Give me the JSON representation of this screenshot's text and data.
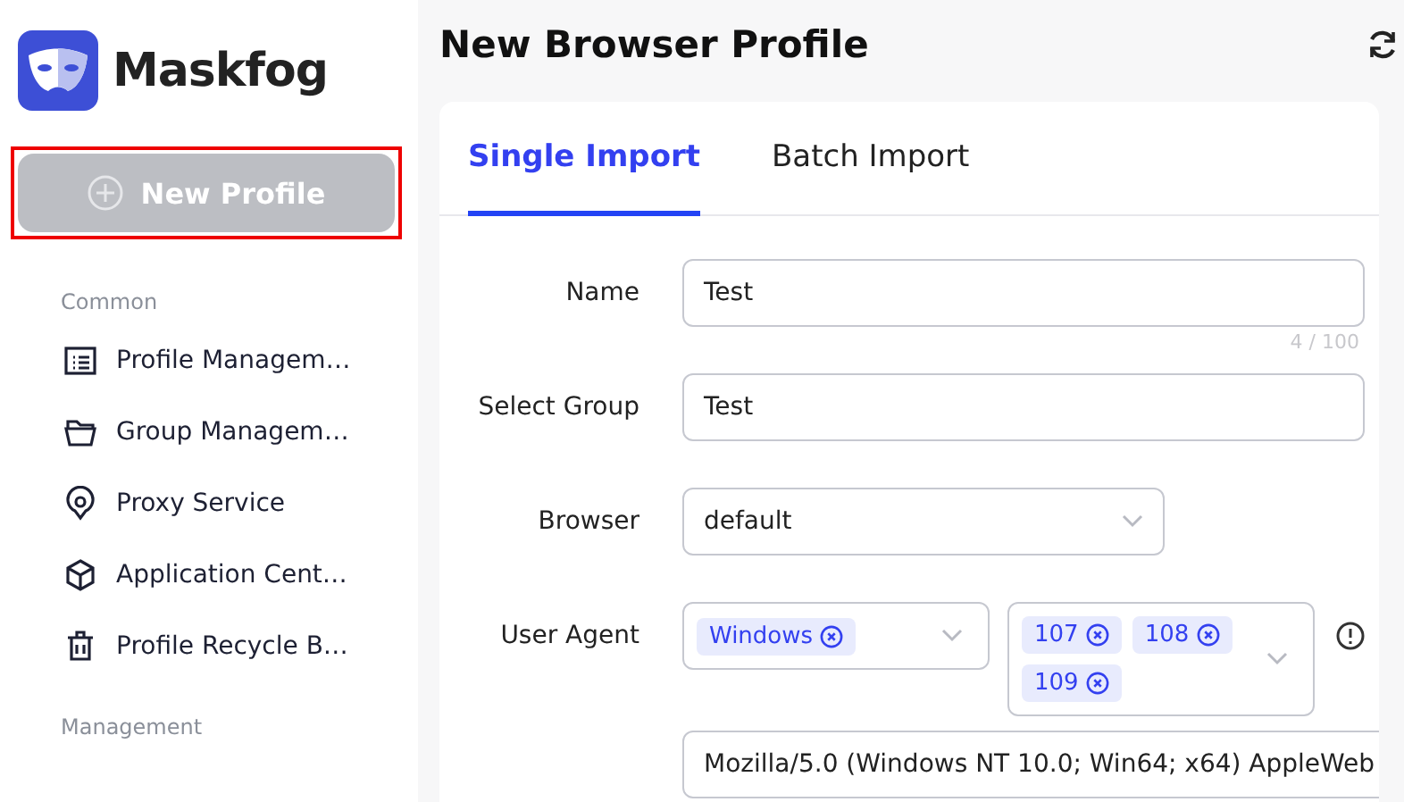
{
  "brand": {
    "name": "Maskfog"
  },
  "new_profile_button": {
    "label": "New Profile",
    "highlighted": true
  },
  "sidebar": {
    "sections": [
      {
        "title": "Common",
        "items": [
          {
            "label": "Profile Managem…",
            "kind": "list"
          },
          {
            "label": "Group Managem…",
            "kind": "folder"
          },
          {
            "label": "Proxy Service",
            "kind": "pin"
          },
          {
            "label": "Application Cent…",
            "kind": "cube"
          },
          {
            "label": "Profile Recycle B…",
            "kind": "trash"
          }
        ]
      },
      {
        "title": "Management"
      }
    ]
  },
  "page": {
    "title": "New Browser Profile"
  },
  "tabs": [
    {
      "label": "Single Import",
      "selected": true
    },
    {
      "label": "Batch Import",
      "selected": false
    }
  ],
  "form": {
    "name": {
      "label": "Name",
      "value": "Test",
      "counter": "4 / 100"
    },
    "group": {
      "label": "Select Group",
      "value": "Test"
    },
    "browser": {
      "label": "Browser",
      "value": "default"
    },
    "user_agent": {
      "label": "User Agent",
      "os_tags": [
        "Windows"
      ],
      "version_tags": [
        "107",
        "108",
        "109"
      ],
      "value": "Mozilla/5.0 (Windows NT 10.0; Win64; x64) AppleWeb"
    }
  }
}
